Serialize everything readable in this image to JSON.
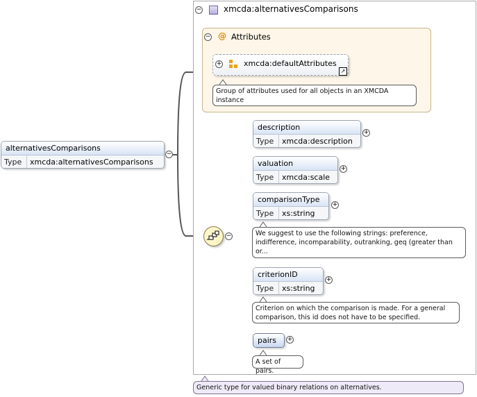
{
  "root": {
    "name": "alternativesComparisons",
    "type_key": "Type",
    "type_value": "xmcda:alternativesComparisons"
  },
  "complex_type": {
    "title": "xmcda:alternativesComparisons",
    "annotation": "Generic type for valued binary relations on alternatives."
  },
  "attributes": {
    "title": "Attributes",
    "group_name": "xmcda:defaultAttributes",
    "annotation": "Group of attributes used for all objects in an XMCDA instance"
  },
  "elements": [
    {
      "name": "description",
      "type_key": "Type",
      "type_value": "xmcda:description",
      "annotation": ""
    },
    {
      "name": "valuation",
      "type_key": "Type",
      "type_value": "xmcda:scale",
      "annotation": ""
    },
    {
      "name": "comparisonType",
      "type_key": "Type",
      "type_value": "xs:string",
      "annotation": "We suggest to use the following strings: preference, indifference, incomparability, outranking, geq (greater than or..."
    },
    {
      "name": "criterionID",
      "type_key": "Type",
      "type_value": "xs:string",
      "annotation": "Criterion on which the comparison is made. For a general comparison, this id does not have to be specified."
    },
    {
      "name": "pairs",
      "annotation": "A set of pairs."
    }
  ],
  "icons": {
    "expand": "+",
    "collapse": "−",
    "attribute_marker": "@"
  },
  "colors": {
    "attributes_bg": "#fdf6e9",
    "sequence_icon_bg": "#fdf6c9",
    "annotation_lav": "#efeaf7",
    "header_blue": "#d8e4f5"
  }
}
